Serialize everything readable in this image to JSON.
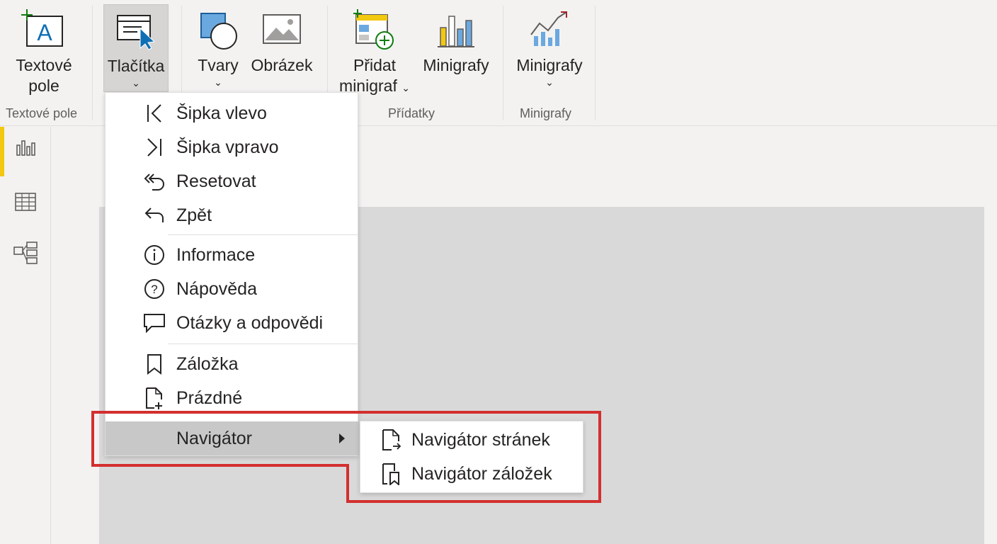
{
  "ribbon": {
    "groups": {
      "textbox": "Textové pole",
      "addons": "Přídatky",
      "sparklines": "Minigrafy"
    },
    "buttons": {
      "textbox": {
        "line1": "Textové",
        "line2": "pole"
      },
      "buttons": {
        "label": "Tlačítka"
      },
      "shapes": {
        "label": "Tvary"
      },
      "image": {
        "label": "Obrázek"
      },
      "add_sparkline": {
        "line1": "Přidat",
        "line2": "minigraf"
      },
      "sparklines_a": {
        "label": "Minigrafy"
      },
      "sparklines_b": {
        "label": "Minigrafy"
      }
    }
  },
  "menu": {
    "items": [
      {
        "label": "Šipka vlevo",
        "icon": "arrow-left-bar-icon"
      },
      {
        "label": "Šipka vpravo",
        "icon": "arrow-right-bar-icon"
      },
      {
        "label": "Resetovat",
        "icon": "reset-icon"
      },
      {
        "label": "Zpět",
        "icon": "back-icon"
      },
      {
        "label": "Informace",
        "icon": "info-icon"
      },
      {
        "label": "Nápověda",
        "icon": "help-icon"
      },
      {
        "label": "Otázky a odpovědi",
        "icon": "qa-icon"
      },
      {
        "label": "Záložka",
        "icon": "bookmark-icon"
      },
      {
        "label": "Prázdné",
        "icon": "blank-page-icon"
      },
      {
        "label": "Navigátor",
        "icon": "submenu-arrow-icon"
      }
    ]
  },
  "submenu": {
    "items": [
      {
        "label": "Navigátor stránek",
        "icon": "page-navigator-icon"
      },
      {
        "label": "Navigátor záložek",
        "icon": "bookmark-navigator-icon"
      }
    ]
  },
  "colors": {
    "accent_rail": "#f2c811",
    "highlight_outline": "#d32f2f",
    "canvas": "#d9d9d9",
    "menu_hover": "#c8c8c8"
  }
}
